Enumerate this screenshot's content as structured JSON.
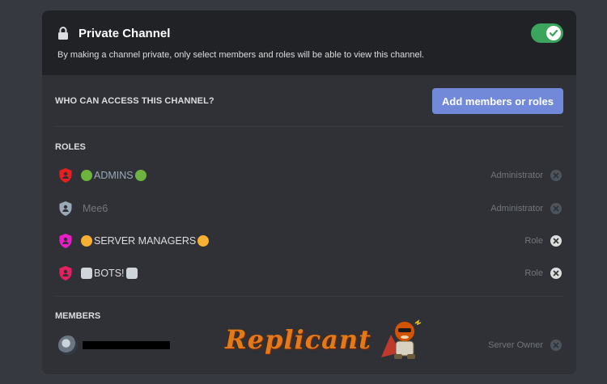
{
  "private_channel": {
    "title": "Private Channel",
    "description": "By making a channel private, only select members and roles will be able to view this channel.",
    "toggle_on": true
  },
  "access": {
    "label": "WHO CAN ACCESS THIS CHANNEL?",
    "add_button": "Add members or roles"
  },
  "roles_section": {
    "label": "ROLES",
    "items": [
      {
        "name": "ADMINS",
        "role": "Administrator",
        "color": "#e91e1e",
        "emoji": "nauseated-face",
        "emoji_color": "#6db33f",
        "removable": false
      },
      {
        "name": "Mee6",
        "role": "Administrator",
        "color": "#99aab5",
        "emoji": "",
        "emoji_color": "",
        "removable": false
      },
      {
        "name": "SERVER MANAGERS",
        "role": "Role",
        "color": "#e91ec6",
        "emoji": "sad-face",
        "emoji_color": "#f5b031",
        "removable": true
      },
      {
        "name": "BOTS!",
        "role": "Role",
        "color": "#e91e63",
        "emoji": "robot-face",
        "emoji_color": "#cfd5da",
        "removable": true
      }
    ]
  },
  "members_section": {
    "label": "MEMBERS",
    "items": [
      {
        "name": "",
        "role": "Server Owner",
        "removable": false
      }
    ]
  },
  "watermark": {
    "text": "Replicant"
  },
  "colors": {
    "background": "#36393f",
    "panel": "#2f3136",
    "panel_header": "#202225",
    "blurple": "#7289da",
    "green": "#3ba55d",
    "muted": "#72767d"
  }
}
